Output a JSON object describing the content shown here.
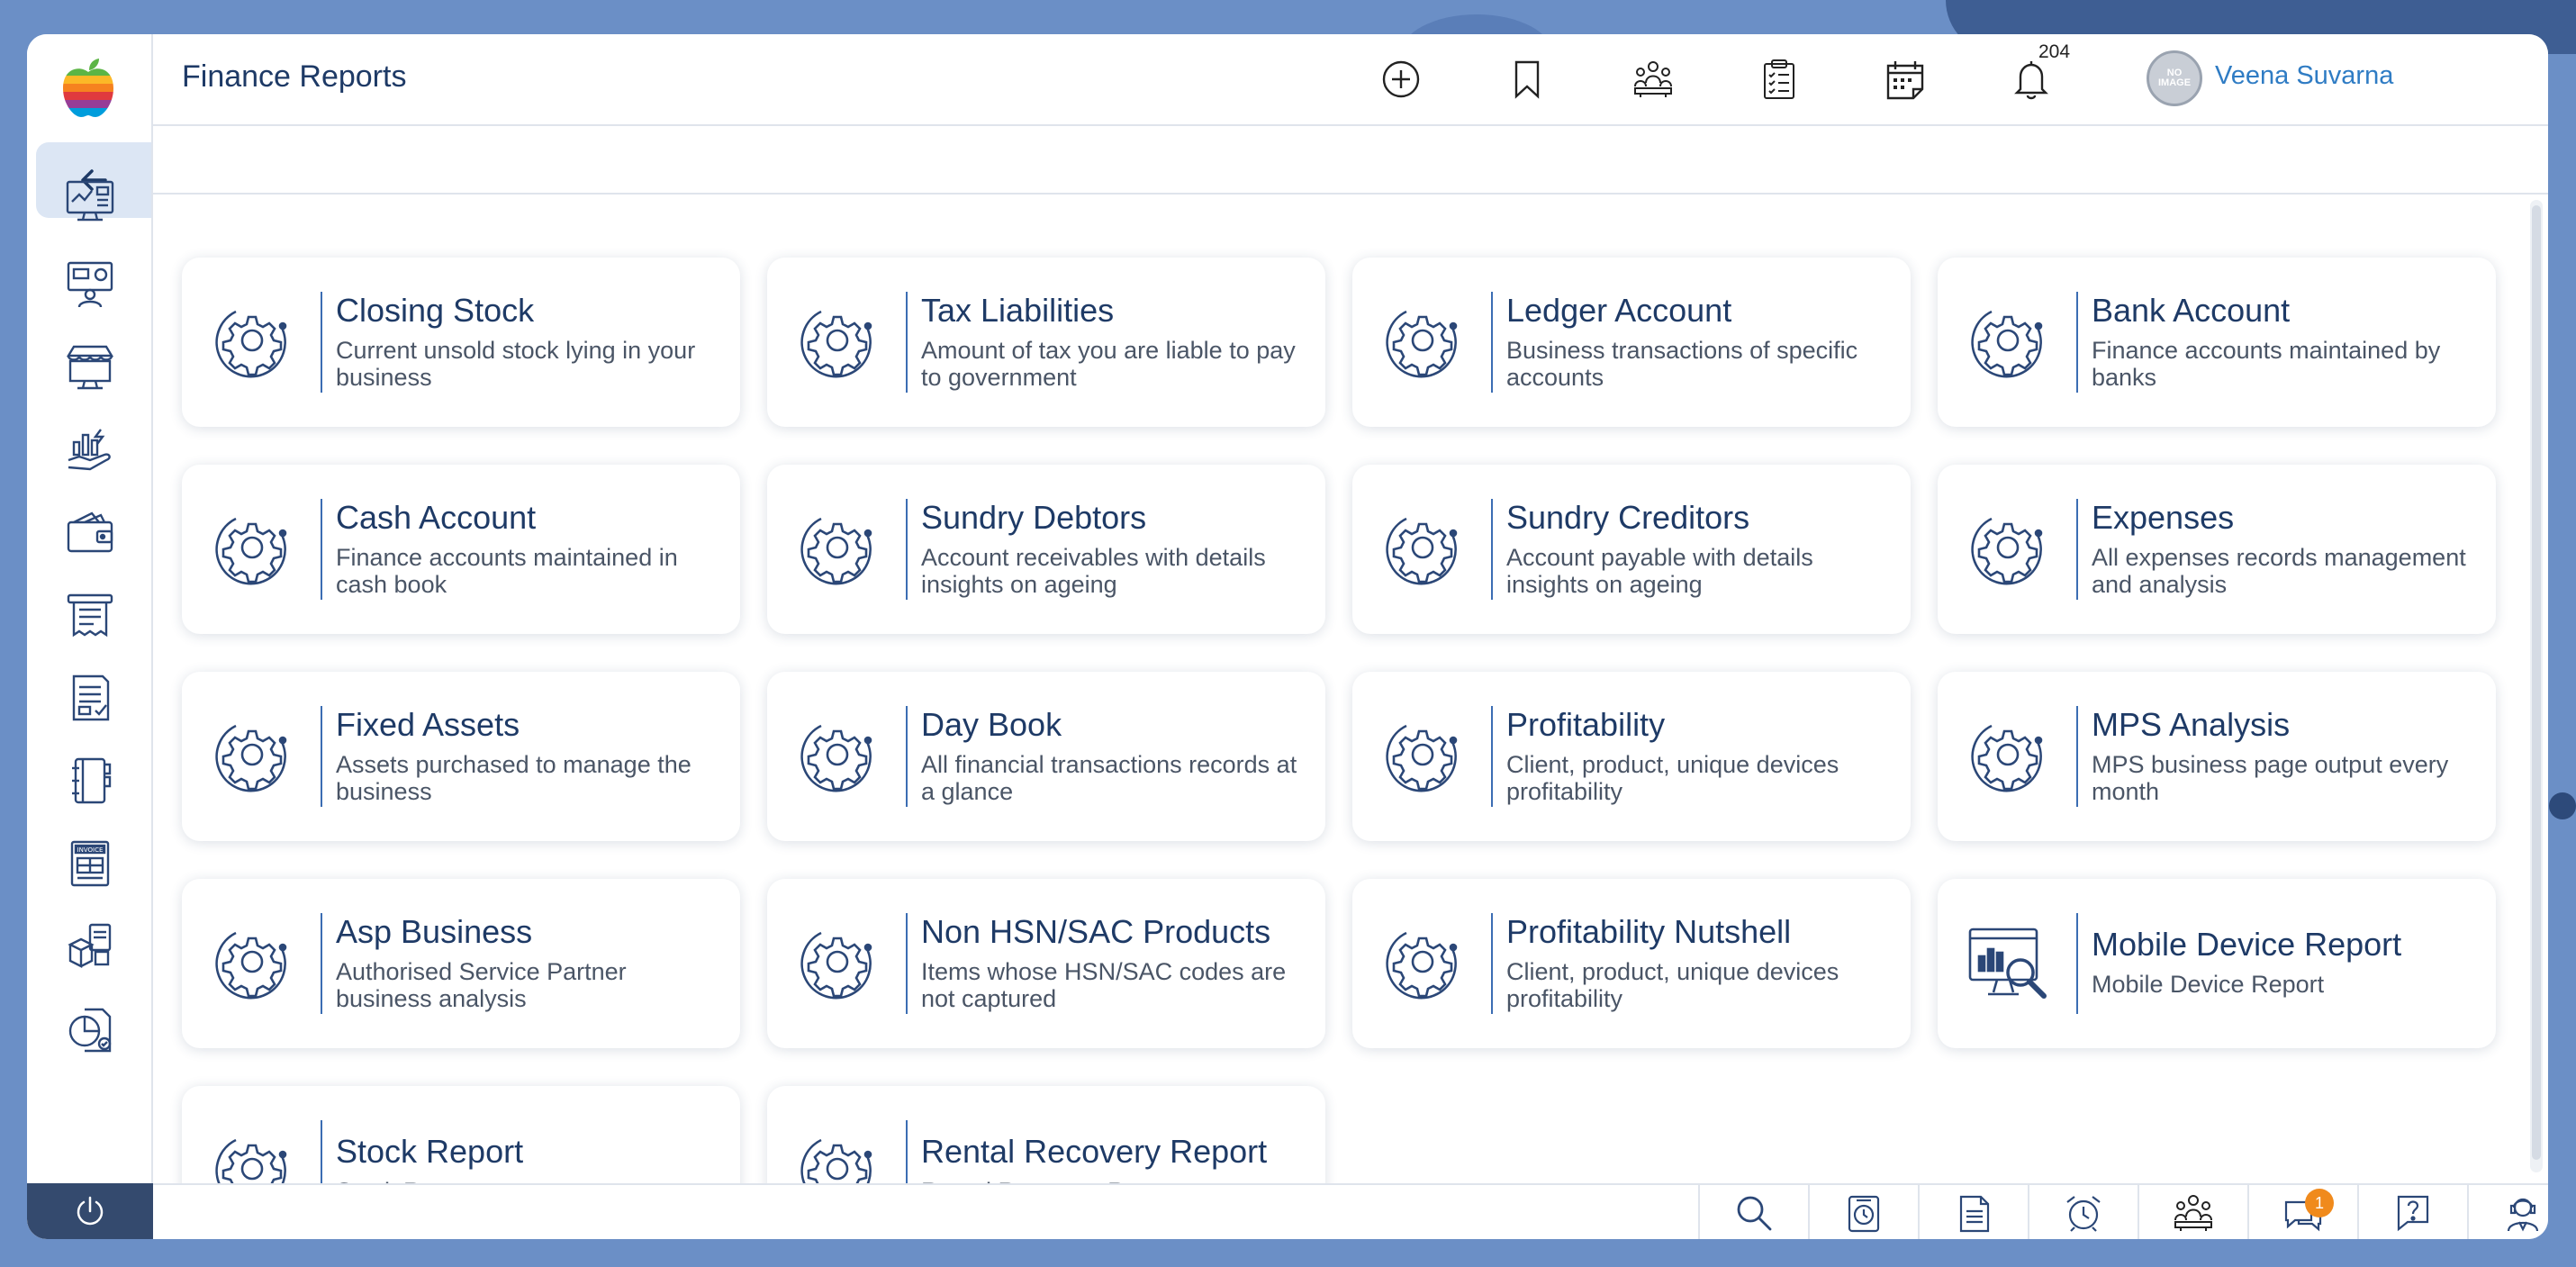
{
  "header": {
    "title": "Finance Reports",
    "notification_count": "204",
    "avatar_text": "NO IMAGE",
    "user_name": "Veena Suvarna"
  },
  "header_icons": [
    "add-circle-icon",
    "bookmark-icon",
    "team-icon",
    "checklist-icon",
    "calendar-icon",
    "bell-icon"
  ],
  "sidebar_icons": [
    "dashboard-icon",
    "presentation-icon",
    "store-icon",
    "finance-hand-icon",
    "wallet-icon",
    "receipt-icon",
    "document-list-icon",
    "notebook-icon",
    "invoice-icon",
    "inventory-icon",
    "report-chart-icon"
  ],
  "reports": [
    {
      "title": "Closing Stock",
      "desc": "Current unsold stock lying in your business",
      "icon": "gear-icon"
    },
    {
      "title": "Tax Liabilities",
      "desc": "Amount of tax you are liable to pay to government",
      "icon": "gear-icon"
    },
    {
      "title": "Ledger Account",
      "desc": "Business transactions of specific accounts",
      "icon": "gear-icon"
    },
    {
      "title": "Bank Account",
      "desc": "Finance accounts maintained by banks",
      "icon": "gear-icon"
    },
    {
      "title": "Cash Account",
      "desc": "Finance accounts maintained in cash book",
      "icon": "gear-icon"
    },
    {
      "title": "Sundry Debtors",
      "desc": "Account receivables with details insights on ageing",
      "icon": "gear-icon"
    },
    {
      "title": "Sundry Creditors",
      "desc": "Account payable with details insights on ageing",
      "icon": "gear-icon"
    },
    {
      "title": "Expenses",
      "desc": "All expenses records management and analysis",
      "icon": "gear-icon"
    },
    {
      "title": "Fixed Assets",
      "desc": "Assets purchased to manage the business",
      "icon": "gear-icon"
    },
    {
      "title": "Day Book",
      "desc": "All financial transactions records at a glance",
      "icon": "gear-icon"
    },
    {
      "title": "Profitability",
      "desc": "Client, product, unique devices profitability",
      "icon": "gear-icon"
    },
    {
      "title": "MPS Analysis",
      "desc": "MPS business page output every month",
      "icon": "gear-icon"
    },
    {
      "title": "Asp Business",
      "desc": "Authorised Service Partner business analysis",
      "icon": "gear-icon"
    },
    {
      "title": "Non HSN/SAC Products",
      "desc": "Items whose  HSN/SAC codes are not captured",
      "icon": "gear-icon"
    },
    {
      "title": "Profitability Nutshell",
      "desc": "Client, product, unique devices profitability",
      "icon": "gear-icon"
    },
    {
      "title": "Mobile Device Report",
      "desc": "Mobile Device Report",
      "icon": "monitor-search-icon"
    },
    {
      "title": "Stock Report",
      "desc": "Stock Report",
      "icon": "gear-icon"
    },
    {
      "title": "Rental Recovery Report",
      "desc": "Rental Recovery Report",
      "icon": "gear-icon"
    }
  ],
  "footer_icons": [
    "search-icon",
    "clock-doc-icon",
    "document-icon",
    "alarm-icon",
    "team-icon",
    "chat-icon",
    "help-icon",
    "support-agent-icon"
  ],
  "footer_badge": "1"
}
